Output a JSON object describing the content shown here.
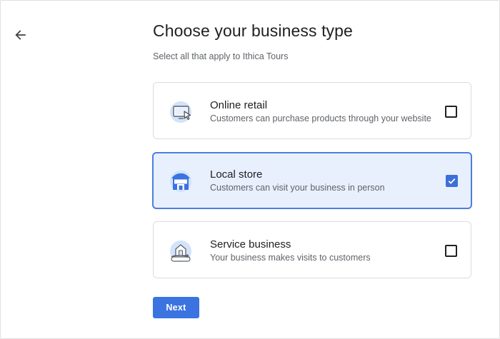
{
  "header": {
    "back_icon": "arrow-left-icon",
    "title": "Choose your business type",
    "subtitle": "Select all that apply to Ithica Tours"
  },
  "options": [
    {
      "title": "Online retail",
      "description": "Customers can purchase products through your website",
      "icon": "monitor-cursor-icon",
      "checked": false
    },
    {
      "title": "Local store",
      "description": "Customers can visit your business in person",
      "icon": "storefront-icon",
      "checked": true
    },
    {
      "title": "Service business",
      "description": "Your business makes visits to customers",
      "icon": "house-pin-icon",
      "checked": false
    }
  ],
  "actions": {
    "next_label": "Next"
  },
  "colors": {
    "accent": "#3b73e0",
    "selected_bg": "#e8f0fe",
    "selected_border": "#4a7fe0",
    "icon_circle": "#d2e3fc"
  }
}
